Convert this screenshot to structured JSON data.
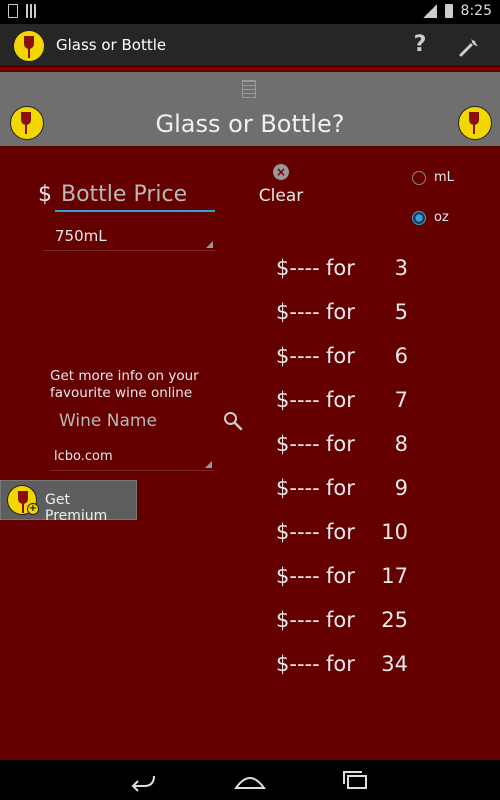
{
  "statusbar": {
    "time": "8:25"
  },
  "actionbar": {
    "title": "Glass or Bottle",
    "help_label": "?"
  },
  "banner": {
    "title": "Glass or Bottle?"
  },
  "price": {
    "currency_symbol": "$",
    "placeholder": "Bottle Price"
  },
  "bottle_size": {
    "selected": "750mL"
  },
  "clear": {
    "label": "Clear"
  },
  "units": {
    "ml_label": "mL",
    "oz_label": "oz",
    "selected": "oz"
  },
  "results": [
    {
      "price": "$----",
      "for": "for",
      "amount": "3"
    },
    {
      "price": "$----",
      "for": "for",
      "amount": "5"
    },
    {
      "price": "$----",
      "for": "for",
      "amount": "6"
    },
    {
      "price": "$----",
      "for": "for",
      "amount": "7"
    },
    {
      "price": "$----",
      "for": "for",
      "amount": "8"
    },
    {
      "price": "$----",
      "for": "for",
      "amount": "9"
    },
    {
      "price": "$----",
      "for": "for",
      "amount": "10"
    },
    {
      "price": "$----",
      "for": "for",
      "amount": "17"
    },
    {
      "price": "$----",
      "for": "for",
      "amount": "25"
    },
    {
      "price": "$----",
      "for": "for",
      "amount": "34"
    }
  ],
  "wine_info": {
    "text_line1": "Get more info on your",
    "text_line2": "favourite wine online",
    "placeholder": "Wine Name",
    "site_selected": "lcbo.com"
  },
  "premium": {
    "label": "Get Premium"
  },
  "colors": {
    "background": "#640000",
    "accent": "#3aa0d8",
    "logo_yellow": "#f2d600",
    "banner": "#6f6f6f"
  }
}
